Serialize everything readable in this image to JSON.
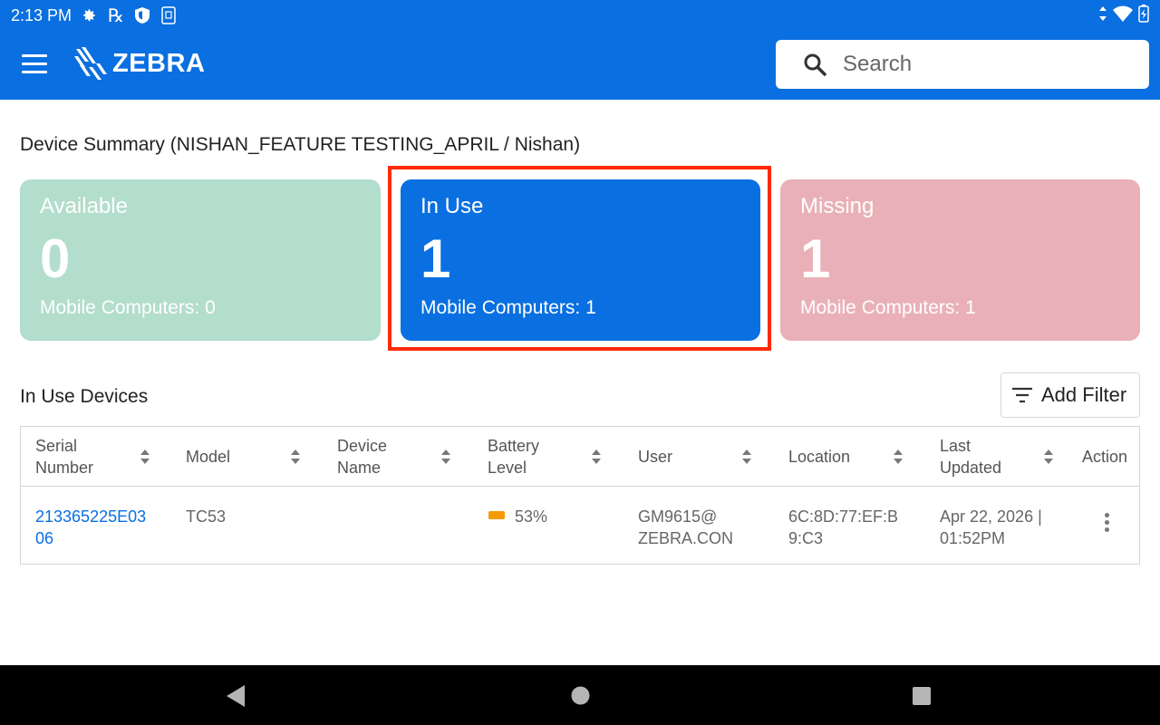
{
  "status_bar": {
    "time": "2:13 PM",
    "icons": [
      "settings-icon",
      "rx-icon",
      "shield-icon",
      "screenshot-icon"
    ],
    "rx_glyph": "℞",
    "right_icons": [
      "data-arrows-icon",
      "wifi-icon",
      "battery-charging-icon"
    ]
  },
  "app_bar": {
    "brand": "ZEBRA",
    "search_placeholder": "Search",
    "color": "#0a6fe0"
  },
  "summary": {
    "title": "Device Summary (NISHAN_FEATURE TESTING_APRIL / Nishan)",
    "cards": [
      {
        "label": "Available",
        "count": "0",
        "sub": "Mobile Computers: 0",
        "color": "#b3ddcc"
      },
      {
        "label": "In Use",
        "count": "1",
        "sub": "Mobile Computers: 1",
        "color": "#0a6fe0"
      },
      {
        "label": "Missing",
        "count": "1",
        "sub": "Mobile Computers: 1",
        "color": "#e9b1b7"
      }
    ]
  },
  "devices": {
    "title": "In Use Devices",
    "add_filter_label": "Add Filter",
    "columns": [
      {
        "line1": "Serial",
        "line2": "Number"
      },
      {
        "line1": "Model",
        "line2": ""
      },
      {
        "line1": "Device",
        "line2": "Name"
      },
      {
        "line1": "Battery",
        "line2": "Level"
      },
      {
        "line1": "User",
        "line2": ""
      },
      {
        "line1": "Location",
        "line2": ""
      },
      {
        "line1": "Last",
        "line2": "Updated"
      },
      {
        "line1": "Action",
        "line2": ""
      }
    ],
    "rows": [
      {
        "serial_1": "213365225E03",
        "serial_2": "06",
        "model": "TC53",
        "device_name": "",
        "battery": "53%",
        "battery_level": 0.53,
        "battery_color": "#f59b00",
        "user_1": "GM9615@",
        "user_2": "ZEBRA.CON",
        "location_1": "6C:8D:77:EF:B",
        "location_2": "9:C3",
        "updated_1": "Apr 22, 2026 |",
        "updated_2": "01:52PM"
      }
    ]
  },
  "highlight_color": "#ff2a00"
}
